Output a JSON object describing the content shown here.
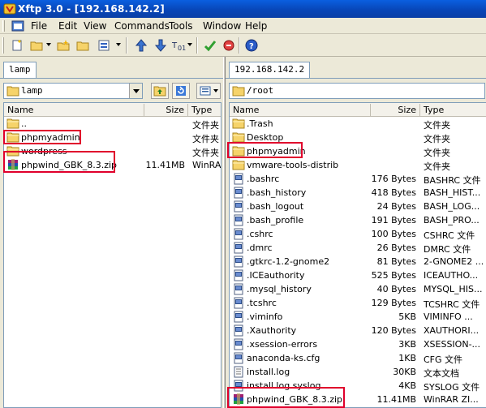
{
  "window": {
    "title": "Xftp 3.0 - [192.168.142.2]"
  },
  "menu": [
    "File",
    "Edit",
    "View",
    "Commands",
    "Tools",
    "Window",
    "Help"
  ],
  "left_pane": {
    "tab": "lamp",
    "path": "lamp",
    "columns": [
      "Name",
      "Size",
      "Type"
    ],
    "items": [
      {
        "name": "..",
        "size": "",
        "type": "文件夹",
        "icon": "folder-icon"
      },
      {
        "name": "phpmyadmin",
        "size": "",
        "type": "文件夹",
        "icon": "folder-icon"
      },
      {
        "name": "wordpress",
        "size": "",
        "type": "文件夹",
        "icon": "folder-icon"
      },
      {
        "name": "phpwind_GBK_8.3.zip",
        "size": "11.41MB",
        "type": "WinRAR",
        "icon": "rar-icon"
      }
    ]
  },
  "right_pane": {
    "tab": "192.168.142.2",
    "path": "/root",
    "columns": [
      "Name",
      "Size",
      "Type"
    ],
    "items": [
      {
        "name": ".Trash",
        "size": "",
        "type": "文件夹",
        "icon": "folder-icon"
      },
      {
        "name": "Desktop",
        "size": "",
        "type": "文件夹",
        "icon": "folder-icon"
      },
      {
        "name": "phpmyadmin",
        "size": "",
        "type": "文件夹",
        "icon": "folder-icon"
      },
      {
        "name": "vmware-tools-distrib",
        "size": "",
        "type": "文件夹",
        "icon": "folder-icon"
      },
      {
        "name": ".bashrc",
        "size": "176 Bytes",
        "type": "BASHRC 文件",
        "icon": "file-icon"
      },
      {
        "name": ".bash_history",
        "size": "418 Bytes",
        "type": "BASH_HIST...",
        "icon": "file-icon"
      },
      {
        "name": ".bash_logout",
        "size": "24 Bytes",
        "type": "BASH_LOG...",
        "icon": "file-icon"
      },
      {
        "name": ".bash_profile",
        "size": "191 Bytes",
        "type": "BASH_PRO...",
        "icon": "file-icon"
      },
      {
        "name": ".cshrc",
        "size": "100 Bytes",
        "type": "CSHRC 文件",
        "icon": "file-icon"
      },
      {
        "name": ".dmrc",
        "size": "26 Bytes",
        "type": "DMRC 文件",
        "icon": "file-icon"
      },
      {
        "name": ".gtkrc-1.2-gnome2",
        "size": "81 Bytes",
        "type": "2-GNOME2 ...",
        "icon": "file-icon"
      },
      {
        "name": ".ICEauthority",
        "size": "525 Bytes",
        "type": "ICEAUTHO...",
        "icon": "file-icon"
      },
      {
        "name": ".mysql_history",
        "size": "40 Bytes",
        "type": "MYSQL_HIS...",
        "icon": "file-icon"
      },
      {
        "name": ".tcshrc",
        "size": "129 Bytes",
        "type": "TCSHRC 文件",
        "icon": "file-icon"
      },
      {
        "name": ".viminfo",
        "size": "5KB",
        "type": "VIMINFO ...",
        "icon": "file-icon"
      },
      {
        "name": ".Xauthority",
        "size": "120 Bytes",
        "type": "XAUTHORI...",
        "icon": "file-icon"
      },
      {
        "name": ".xsession-errors",
        "size": "3KB",
        "type": "XSESSION-...",
        "icon": "file-icon"
      },
      {
        "name": "anaconda-ks.cfg",
        "size": "1KB",
        "type": "CFG 文件",
        "icon": "file-icon"
      },
      {
        "name": "install.log",
        "size": "30KB",
        "type": "文本文档",
        "icon": "text-file-icon"
      },
      {
        "name": "install.log.syslog",
        "size": "4KB",
        "type": "SYSLOG 文件",
        "icon": "file-icon"
      },
      {
        "name": "phpwind_GBK_8.3.zip",
        "size": "11.41MB",
        "type": "WinRAR ZI...",
        "icon": "rar-icon"
      }
    ]
  },
  "accent_color": "#e0002c"
}
